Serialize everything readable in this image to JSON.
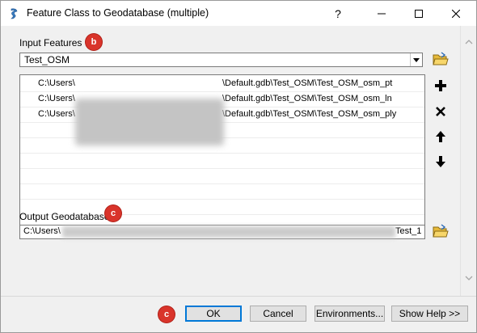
{
  "window": {
    "title": "Feature Class to Geodatabase (multiple)",
    "help_label": "?"
  },
  "form": {
    "input_features_label": "Input Features",
    "input_features_value": "Test_OSM",
    "features_list": [
      {
        "path_start": "C:\\Users\\",
        "path_end": "\\Default.gdb\\Test_OSM\\Test_OSM_osm_pt"
      },
      {
        "path_start": "C:\\Users\\",
        "path_end": "\\Default.gdb\\Test_OSM\\Test_OSM_osm_ln"
      },
      {
        "path_start": "C:\\Users\\",
        "path_end": "\\Default.gdb\\Test_OSM\\Test_OSM_osm_ply"
      }
    ],
    "output_gdb_label": "Output Geodatabase",
    "output_gdb_value_start": "C:\\Users\\",
    "output_gdb_value_end": "Test_1"
  },
  "badges": {
    "b": "b",
    "c1": "c",
    "c2": "c"
  },
  "buttons": {
    "ok": "OK",
    "cancel": "Cancel",
    "environments": "Environments...",
    "show_help": "Show Help >>"
  },
  "colors": {
    "badge": "#d9342b",
    "accent": "#0078d7"
  }
}
